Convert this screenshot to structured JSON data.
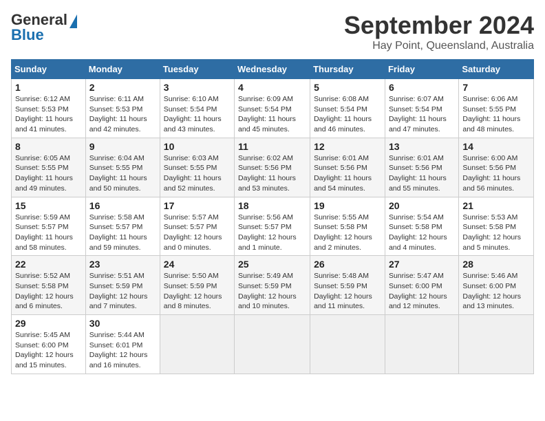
{
  "header": {
    "logo_line1": "General",
    "logo_line2": "Blue",
    "title": "September 2024",
    "subtitle": "Hay Point, Queensland, Australia"
  },
  "calendar": {
    "days_of_week": [
      "Sunday",
      "Monday",
      "Tuesday",
      "Wednesday",
      "Thursday",
      "Friday",
      "Saturday"
    ],
    "weeks": [
      [
        null,
        {
          "day": "1",
          "sunrise": "6:12 AM",
          "sunset": "5:53 PM",
          "daylight": "11 hours and 41 minutes."
        },
        {
          "day": "2",
          "sunrise": "6:11 AM",
          "sunset": "5:53 PM",
          "daylight": "11 hours and 42 minutes."
        },
        {
          "day": "3",
          "sunrise": "6:10 AM",
          "sunset": "5:54 PM",
          "daylight": "11 hours and 43 minutes."
        },
        {
          "day": "4",
          "sunrise": "6:09 AM",
          "sunset": "5:54 PM",
          "daylight": "11 hours and 45 minutes."
        },
        {
          "day": "5",
          "sunrise": "6:08 AM",
          "sunset": "5:54 PM",
          "daylight": "11 hours and 46 minutes."
        },
        {
          "day": "6",
          "sunrise": "6:07 AM",
          "sunset": "5:54 PM",
          "daylight": "11 hours and 47 minutes."
        },
        {
          "day": "7",
          "sunrise": "6:06 AM",
          "sunset": "5:55 PM",
          "daylight": "11 hours and 48 minutes."
        }
      ],
      [
        {
          "day": "8",
          "sunrise": "6:05 AM",
          "sunset": "5:55 PM",
          "daylight": "11 hours and 49 minutes."
        },
        {
          "day": "9",
          "sunrise": "6:04 AM",
          "sunset": "5:55 PM",
          "daylight": "11 hours and 50 minutes."
        },
        {
          "day": "10",
          "sunrise": "6:03 AM",
          "sunset": "5:55 PM",
          "daylight": "11 hours and 52 minutes."
        },
        {
          "day": "11",
          "sunrise": "6:02 AM",
          "sunset": "5:56 PM",
          "daylight": "11 hours and 53 minutes."
        },
        {
          "day": "12",
          "sunrise": "6:01 AM",
          "sunset": "5:56 PM",
          "daylight": "11 hours and 54 minutes."
        },
        {
          "day": "13",
          "sunrise": "6:01 AM",
          "sunset": "5:56 PM",
          "daylight": "11 hours and 55 minutes."
        },
        {
          "day": "14",
          "sunrise": "6:00 AM",
          "sunset": "5:56 PM",
          "daylight": "11 hours and 56 minutes."
        }
      ],
      [
        {
          "day": "15",
          "sunrise": "5:59 AM",
          "sunset": "5:57 PM",
          "daylight": "11 hours and 58 minutes."
        },
        {
          "day": "16",
          "sunrise": "5:58 AM",
          "sunset": "5:57 PM",
          "daylight": "11 hours and 59 minutes."
        },
        {
          "day": "17",
          "sunrise": "5:57 AM",
          "sunset": "5:57 PM",
          "daylight": "12 hours and 0 minutes."
        },
        {
          "day": "18",
          "sunrise": "5:56 AM",
          "sunset": "5:57 PM",
          "daylight": "12 hours and 1 minute."
        },
        {
          "day": "19",
          "sunrise": "5:55 AM",
          "sunset": "5:58 PM",
          "daylight": "12 hours and 2 minutes."
        },
        {
          "day": "20",
          "sunrise": "5:54 AM",
          "sunset": "5:58 PM",
          "daylight": "12 hours and 4 minutes."
        },
        {
          "day": "21",
          "sunrise": "5:53 AM",
          "sunset": "5:58 PM",
          "daylight": "12 hours and 5 minutes."
        }
      ],
      [
        {
          "day": "22",
          "sunrise": "5:52 AM",
          "sunset": "5:58 PM",
          "daylight": "12 hours and 6 minutes."
        },
        {
          "day": "23",
          "sunrise": "5:51 AM",
          "sunset": "5:59 PM",
          "daylight": "12 hours and 7 minutes."
        },
        {
          "day": "24",
          "sunrise": "5:50 AM",
          "sunset": "5:59 PM",
          "daylight": "12 hours and 8 minutes."
        },
        {
          "day": "25",
          "sunrise": "5:49 AM",
          "sunset": "5:59 PM",
          "daylight": "12 hours and 10 minutes."
        },
        {
          "day": "26",
          "sunrise": "5:48 AM",
          "sunset": "5:59 PM",
          "daylight": "12 hours and 11 minutes."
        },
        {
          "day": "27",
          "sunrise": "5:47 AM",
          "sunset": "6:00 PM",
          "daylight": "12 hours and 12 minutes."
        },
        {
          "day": "28",
          "sunrise": "5:46 AM",
          "sunset": "6:00 PM",
          "daylight": "12 hours and 13 minutes."
        }
      ],
      [
        {
          "day": "29",
          "sunrise": "5:45 AM",
          "sunset": "6:00 PM",
          "daylight": "12 hours and 15 minutes."
        },
        {
          "day": "30",
          "sunrise": "5:44 AM",
          "sunset": "6:01 PM",
          "daylight": "12 hours and 16 minutes."
        },
        null,
        null,
        null,
        null,
        null
      ]
    ]
  }
}
